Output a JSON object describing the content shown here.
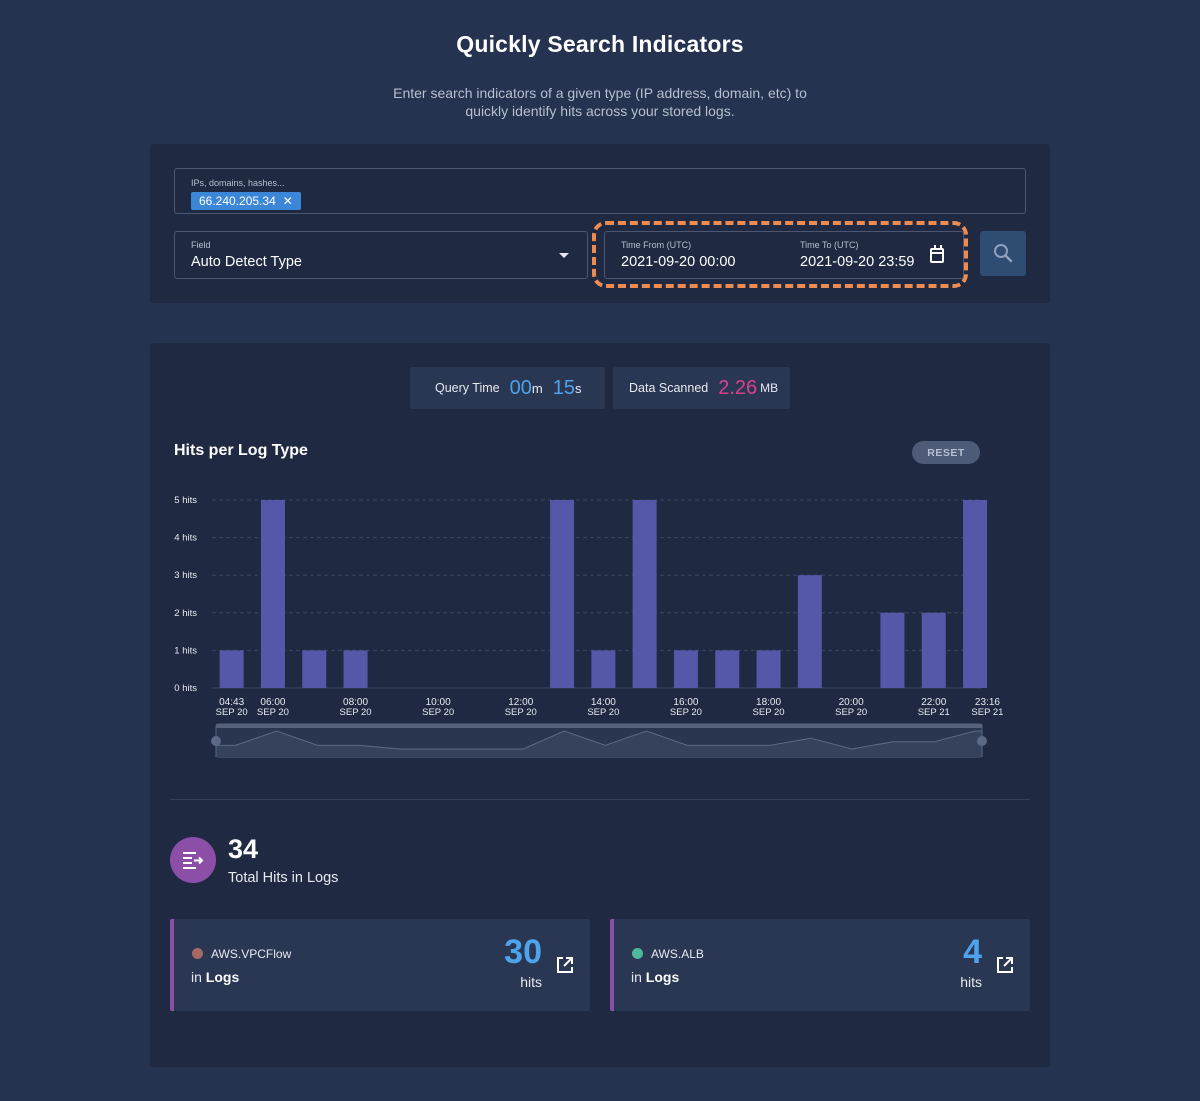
{
  "header": {
    "title": "Quickly Search Indicators",
    "subtitle_line1": "Enter search indicators of a given type (IP address, domain, etc) to",
    "subtitle_line2": "quickly identify hits across your stored logs."
  },
  "search": {
    "indicators_label": "IPs, domains, hashes...",
    "indicator_tag": "66.240.205.34",
    "field_label": "Field",
    "field_value": "Auto Detect Type",
    "time_from_label": "Time From (UTC)",
    "time_from_value": "2021-09-20 00:00",
    "time_to_label": "Time To (UTC)",
    "time_to_value": "2021-09-20 23:59",
    "highlight_color": "#ef8b4f"
  },
  "stats": {
    "query_time_label": "Query Time",
    "query_minutes": "00",
    "minutes_unit": "m",
    "query_seconds": "15",
    "seconds_unit": "s",
    "data_scanned_label": "Data Scanned",
    "data_scanned_value": "2.26",
    "data_scanned_unit": "MB"
  },
  "chart_section": {
    "title": "Hits per Log Type",
    "reset_label": "RESET"
  },
  "chart_data": {
    "type": "bar",
    "title": "Hits per Log Type",
    "y_ticks": [
      "0 hits",
      "1 hits",
      "2 hits",
      "3 hits",
      "4 hits",
      "5 hits"
    ],
    "ylim": [
      0,
      5
    ],
    "grid": true,
    "x_tick_labels": [
      {
        "time": "04:43",
        "date": "SEP 20",
        "slot": 0
      },
      {
        "time": "06:00",
        "date": "SEP 20",
        "slot": 1
      },
      {
        "time": "08:00",
        "date": "SEP 20",
        "slot": 3
      },
      {
        "time": "10:00",
        "date": "SEP 20",
        "slot": 5
      },
      {
        "time": "12:00",
        "date": "SEP 20",
        "slot": 7
      },
      {
        "time": "14:00",
        "date": "SEP 20",
        "slot": 9
      },
      {
        "time": "16:00",
        "date": "SEP 20",
        "slot": 11
      },
      {
        "time": "18:00",
        "date": "SEP 20",
        "slot": 13
      },
      {
        "time": "20:00",
        "date": "SEP 20",
        "slot": 15
      },
      {
        "time": "22:00",
        "date": "SEP 21",
        "slot": 17
      },
      {
        "time": "23:16",
        "date": "SEP 21",
        "slot": 18.3
      }
    ],
    "values": [
      1,
      5,
      1,
      1,
      0,
      0,
      0,
      0,
      5,
      1,
      5,
      1,
      1,
      1,
      3,
      0,
      2,
      2,
      5
    ],
    "bar_color": "#5557a8"
  },
  "totals": {
    "total_hits": "34",
    "total_label": "Total Hits in Logs",
    "icon": "list-arrow-icon"
  },
  "log_cards": [
    {
      "name": "AWS.VPCFlow",
      "in_prefix": "in",
      "in_label": "Logs",
      "count": "30",
      "hits_label": "hits",
      "dot_color": "#a56a63"
    },
    {
      "name": "AWS.ALB",
      "in_prefix": "in",
      "in_label": "Logs",
      "count": "4",
      "hits_label": "hits",
      "dot_color": "#4fb89a"
    }
  ]
}
